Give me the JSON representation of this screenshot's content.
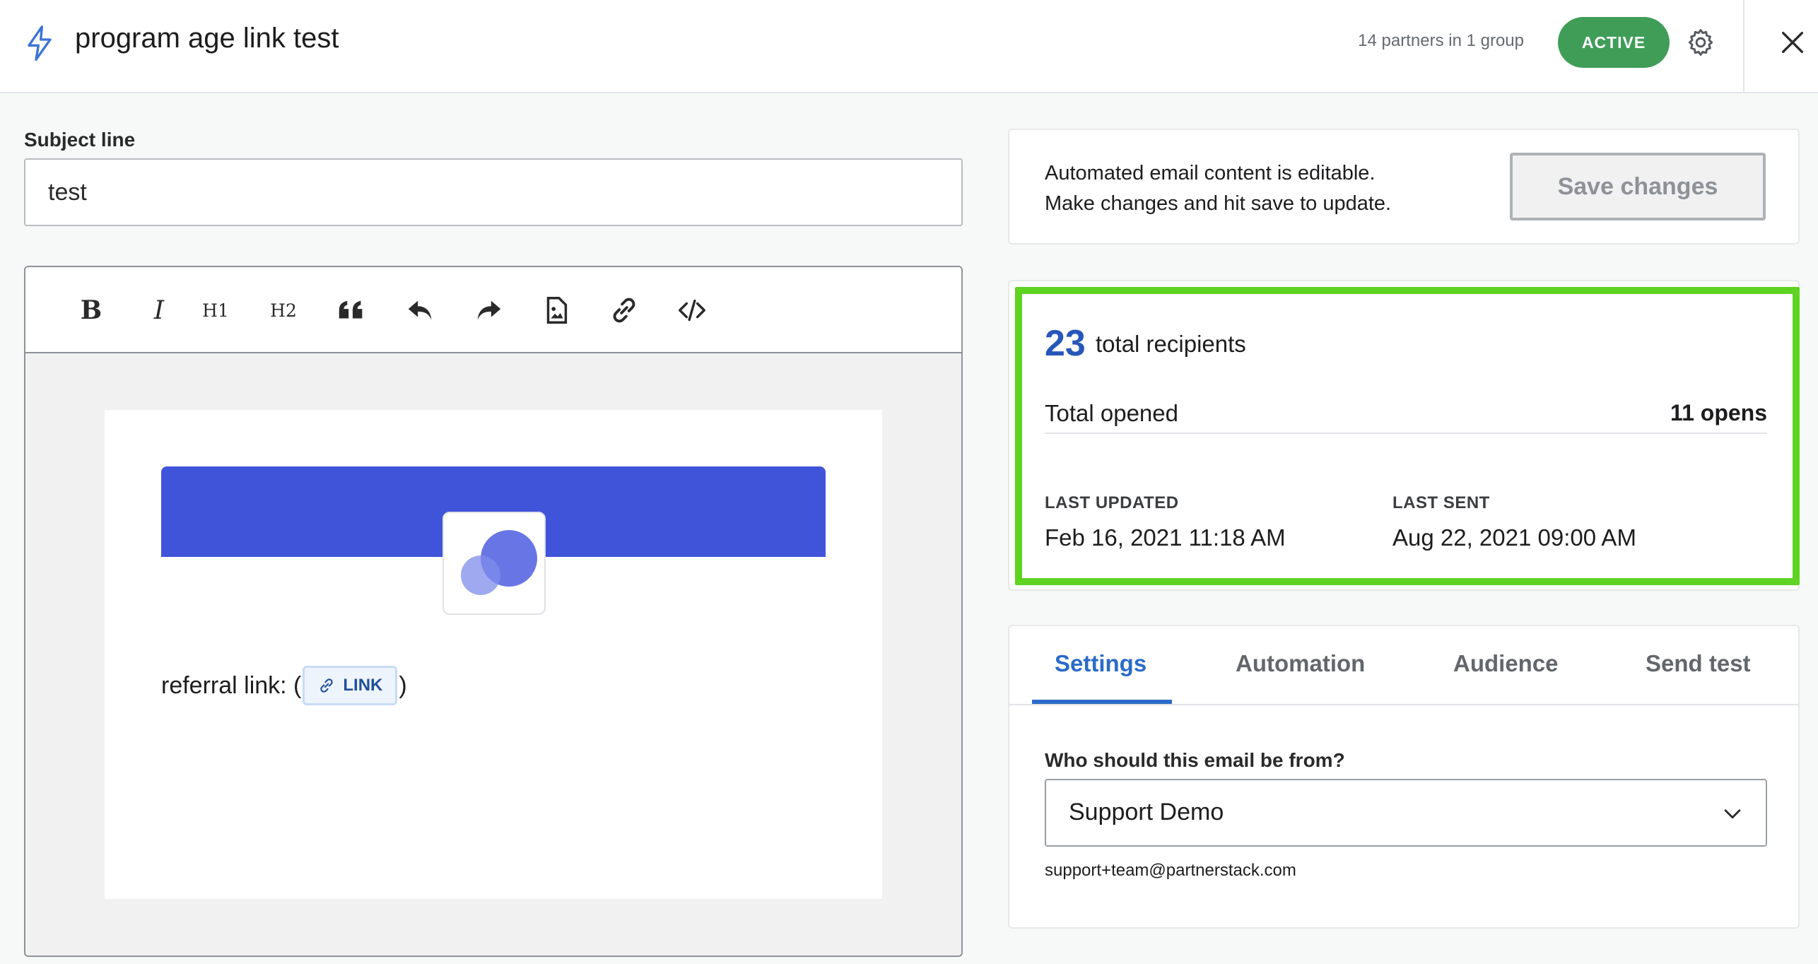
{
  "header": {
    "title": "program age link test",
    "partners_text": "14 partners in 1 group",
    "status_badge": "ACTIVE"
  },
  "subject": {
    "label": "Subject line",
    "value": "test"
  },
  "toolbar": {
    "bold": "B",
    "italic": "I",
    "h1": "H1",
    "h2": "H2"
  },
  "email_body": {
    "referral_prefix": "referral link: (",
    "link_chip": "LINK",
    "referral_suffix": ")"
  },
  "info_card": {
    "line1": "Automated email content is editable.",
    "line2": "Make changes and hit save to update.",
    "save_label": "Save changes"
  },
  "stats": {
    "total_recipients": "23",
    "total_recipients_label": "total recipients",
    "total_opened_label": "Total opened",
    "total_opened_value": "11 opens",
    "last_updated_label": "LAST UPDATED",
    "last_updated_value": "Feb 16, 2021 11:18 AM",
    "last_sent_label": "LAST SENT",
    "last_sent_value": "Aug 22, 2021 09:00 AM"
  },
  "tabs": [
    {
      "label": "Settings",
      "active": true
    },
    {
      "label": "Automation",
      "active": false
    },
    {
      "label": "Audience",
      "active": false
    },
    {
      "label": "Send test",
      "active": false
    }
  ],
  "settings": {
    "from_label": "Who should this email be from?",
    "from_value": "Support Demo",
    "from_email": "support+team@partnerstack.com"
  },
  "colors": {
    "active_badge": "#3f9d58",
    "accent_blue": "#2b6bc9",
    "banner": "#4054d9",
    "highlight": "#5fd322"
  },
  "icons": [
    "bolt-icon",
    "gear-icon",
    "close-icon",
    "bold-icon",
    "italic-icon",
    "quote-icon",
    "undo-icon",
    "redo-icon",
    "image-file-icon",
    "link-icon",
    "code-icon",
    "chevron-down-icon"
  ]
}
